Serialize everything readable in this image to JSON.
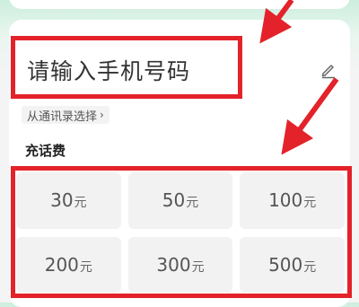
{
  "phone": {
    "placeholder": "请输入手机号码",
    "edit_icon": "pencil-icon"
  },
  "contacts": {
    "label": "从通讯录选择",
    "chevron": "›"
  },
  "section": {
    "title": "充话费"
  },
  "amounts": [
    {
      "value": "30",
      "unit": "元"
    },
    {
      "value": "50",
      "unit": "元"
    },
    {
      "value": "100",
      "unit": "元"
    },
    {
      "value": "200",
      "unit": "元"
    },
    {
      "value": "300",
      "unit": "元"
    },
    {
      "value": "500",
      "unit": "元"
    }
  ],
  "colors": {
    "annotation": "#e4222a",
    "tile_bg": "#f2f2f2"
  }
}
